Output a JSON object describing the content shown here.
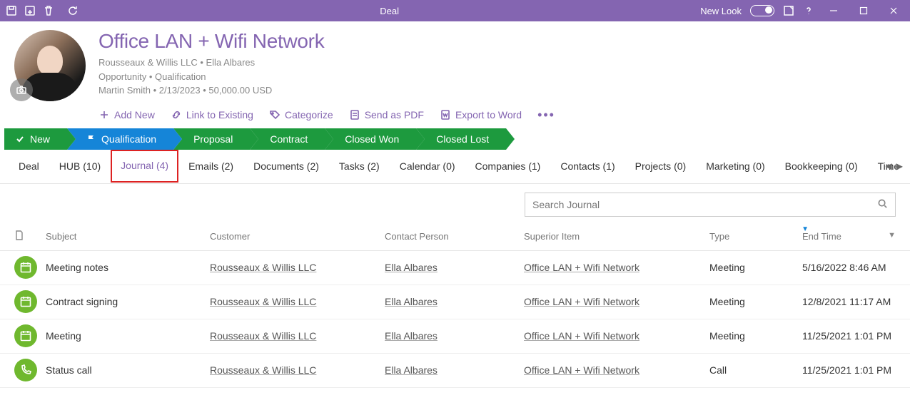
{
  "titlebar": {
    "title": "Deal",
    "newlook_label": "New Look"
  },
  "header": {
    "title": "Office LAN + Wifi Network",
    "company": "Rousseaux & Willis LLC",
    "contact": "Ella Albares",
    "stage_line": "Opportunity",
    "stage_status": "Qualification",
    "owner": "Martin Smith",
    "date": "2/13/2023",
    "amount": "50,000.00 USD",
    "actions": {
      "add_new": "Add New",
      "link_existing": "Link to Existing",
      "categorize": "Categorize",
      "send_pdf": "Send as PDF",
      "export_word": "Export to Word"
    }
  },
  "stages": [
    {
      "label": "New",
      "color": "green",
      "icon": "check"
    },
    {
      "label": "Qualification",
      "color": "blue",
      "icon": "flag"
    },
    {
      "label": "Proposal",
      "color": "green",
      "icon": "none"
    },
    {
      "label": "Contract",
      "color": "green",
      "icon": "none"
    },
    {
      "label": "Closed Won",
      "color": "green",
      "icon": "none"
    },
    {
      "label": "Closed Lost",
      "color": "green",
      "icon": "none"
    }
  ],
  "tabs": [
    {
      "label": "Deal"
    },
    {
      "label": "HUB (10)"
    },
    {
      "label": "Journal (4)",
      "active": true,
      "highlighted": true
    },
    {
      "label": "Emails (2)"
    },
    {
      "label": "Documents (2)"
    },
    {
      "label": "Tasks (2)"
    },
    {
      "label": "Calendar (0)"
    },
    {
      "label": "Companies (1)"
    },
    {
      "label": "Contacts (1)"
    },
    {
      "label": "Projects (0)"
    },
    {
      "label": "Marketing (0)"
    },
    {
      "label": "Bookkeeping (0)"
    },
    {
      "label": "Time"
    }
  ],
  "search": {
    "placeholder": "Search Journal"
  },
  "columns": {
    "subject": "Subject",
    "customer": "Customer",
    "contact": "Contact Person",
    "superior": "Superior Item",
    "type": "Type",
    "end": "End Time"
  },
  "rows": [
    {
      "icon": "calendar",
      "subject": "Meeting notes",
      "customer": "Rousseaux & Willis LLC",
      "contact": "Ella Albares",
      "superior": "Office LAN + Wifi Network",
      "type": "Meeting",
      "end": "5/16/2022 8:46 AM"
    },
    {
      "icon": "calendar",
      "subject": "Contract signing",
      "customer": "Rousseaux & Willis LLC",
      "contact": "Ella Albares",
      "superior": "Office LAN + Wifi Network",
      "type": "Meeting",
      "end": "12/8/2021 11:17 AM"
    },
    {
      "icon": "calendar",
      "subject": "Meeting",
      "customer": "Rousseaux & Willis LLC",
      "contact": "Ella Albares",
      "superior": "Office LAN + Wifi Network",
      "type": "Meeting",
      "end": "11/25/2021 1:01 PM"
    },
    {
      "icon": "phone",
      "subject": "Status call",
      "customer": "Rousseaux & Willis LLC",
      "contact": "Ella Albares",
      "superior": "Office LAN + Wifi Network",
      "type": "Call",
      "end": "11/25/2021 1:01 PM"
    }
  ]
}
